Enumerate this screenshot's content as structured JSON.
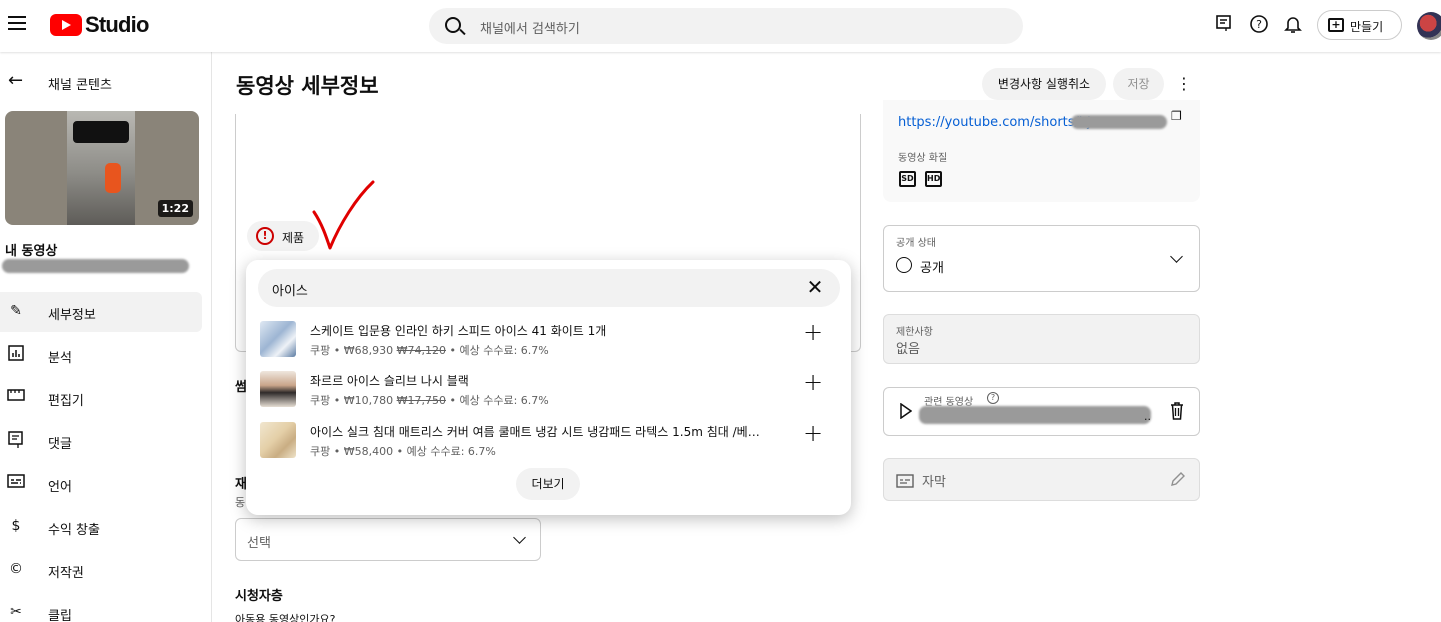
{
  "header": {
    "logo_text": "Studio",
    "search_placeholder": "채널에서 검색하기",
    "create_label": "만들기",
    "icons": [
      "menu-icon",
      "feedback-icon",
      "help-icon",
      "notifications-icon",
      "create-icon"
    ]
  },
  "sidebar": {
    "back_label": "채널 콘텐츠",
    "thumbnail_duration": "1:22",
    "video_section_label": "내 동영상",
    "items": [
      {
        "label": "세부정보",
        "icon": "pencil-icon",
        "active": true
      },
      {
        "label": "분석",
        "icon": "analytics-icon"
      },
      {
        "label": "편집기",
        "icon": "editor-icon"
      },
      {
        "label": "댓글",
        "icon": "comments-icon"
      },
      {
        "label": "언어",
        "icon": "subtitles-icon"
      },
      {
        "label": "수익 창출",
        "icon": "dollar-icon"
      },
      {
        "label": "저작권",
        "icon": "copyright-icon"
      },
      {
        "label": "클립",
        "icon": "scissors-icon"
      }
    ]
  },
  "main": {
    "title": "동영상 세부정보",
    "undo_label": "변경사항 실행취소",
    "save_label": "저장",
    "product_chip_label": "제품",
    "thumb_section_partial": "썸",
    "playlist_partial": "재",
    "playlist_sub_partial": "동",
    "select_label": "선택",
    "audience_title": "시청자층",
    "audience_question": "아동용 동영상인가요?"
  },
  "right": {
    "video_link": "https://youtube.com/shorts/bj",
    "quality_label": "동영상 화질",
    "quality_badges": [
      "SD",
      "HD"
    ],
    "visibility_label": "공개 상태",
    "visibility_value": "공개",
    "restrictions_label": "제한사항",
    "restrictions_value": "없음",
    "related_label": "관련 동영상",
    "related_ellipsis": "..",
    "subtitles_label": "자막"
  },
  "popup": {
    "search_value": "아이스",
    "products": [
      {
        "title": "스케이트 입문용 인라인 하키 스피드 아이스 41 화이트 1개",
        "store": "쿠팡",
        "price": "₩68,930",
        "original_price": "₩74,120",
        "commission": "예상 수수료: 6.7%"
      },
      {
        "title": "좌르르 아이스 슬리브 나시 블랙",
        "store": "쿠팡",
        "price": "₩10,780",
        "original_price": "₩17,750",
        "commission": "예상 수수료: 6.7%"
      },
      {
        "title": "아이스 실크 침대 매트리스 커버 여름 쿨매트 냉감 시트 냉감패드 라텍스 1.5m 침대 /베게커버...",
        "store": "쿠팡",
        "price": "₩58,400",
        "original_price": "",
        "commission": "예상 수수료: 6.7%"
      }
    ],
    "more_label": "더보기"
  },
  "colors": {
    "brand_red": "#ff0000",
    "link_blue": "#065fd4",
    "annotation_red": "#e00000"
  }
}
